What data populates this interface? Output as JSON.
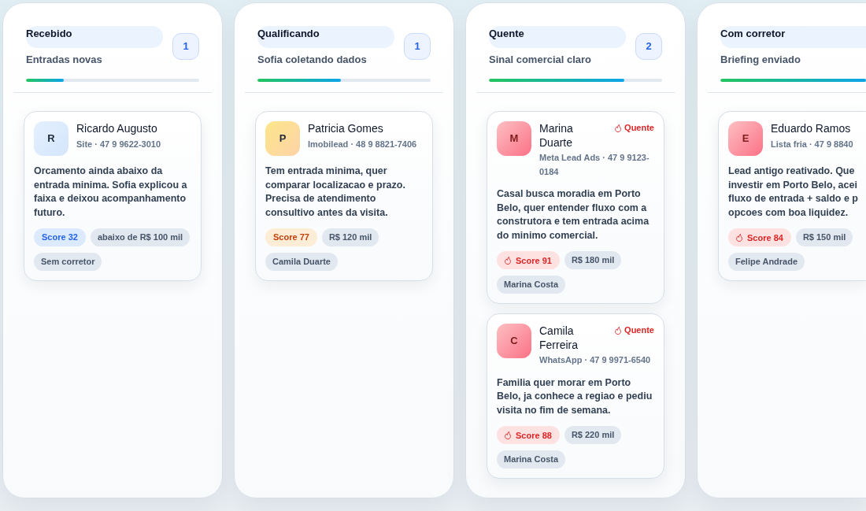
{
  "columns": [
    {
      "title": "Recebido",
      "subtitle": "Entradas novas",
      "count": "1",
      "level": 0.22,
      "cards": [
        {
          "initial": "R",
          "name": "Ricardo Augusto",
          "source": "Site · 47 9 9622-3010",
          "kind": "cold",
          "description": "Orcamento ainda abaixo da entrada minima. Sofia explicou a faixa e deixou acompanhamento futuro.",
          "score": "Score 32",
          "tags": [
            "abaixo de R$ 100 mil",
            "Sem corretor"
          ]
        }
      ]
    },
    {
      "title": "Qualificando",
      "subtitle": "Sofia coletando dados",
      "count": "1",
      "level": 0.48,
      "cards": [
        {
          "initial": "P",
          "name": "Patricia Gomes",
          "source": "Imobilead · 48 9 8821-7406",
          "kind": "warm",
          "description": "Tem entrada minima, quer comparar localizacao e prazo. Precisa de atendimento consultivo antes da visita.",
          "score": "Score 77",
          "tags": [
            "R$ 120 mil",
            "Camila Duarte"
          ]
        }
      ]
    },
    {
      "title": "Quente",
      "subtitle": "Sinal comercial claro",
      "count": "2",
      "level": 0.78,
      "cards": [
        {
          "initial": "M",
          "name": "Marina Duarte",
          "badge": "Quente",
          "source": "Meta Lead Ads · 47 9 9123-0184",
          "kind": "hot",
          "description": "Casal busca moradia em Porto Belo, quer entender fluxo com a construtora e tem entrada acima do minimo comercial.",
          "score": "Score 91",
          "tags": [
            "R$ 180 mil",
            "Marina Costa"
          ]
        },
        {
          "initial": "C",
          "name": "Camila Ferreira",
          "badge": "Quente",
          "source": "WhatsApp · 47 9 9971-6540",
          "kind": "hot",
          "description": "Familia quer morar em Porto Belo, ja conhece a regiao e pediu visita no fim de semana.",
          "score": "Score 88",
          "tags": [
            "R$ 220 mil",
            "Marina Costa"
          ]
        }
      ]
    },
    {
      "title": "Com corretor",
      "subtitle": "Briefing enviado",
      "level": 1,
      "cards": [
        {
          "initial": "E",
          "name": "Eduardo Ramos",
          "source": "Lista fria · 47 9 8840",
          "kind": "hot",
          "description": "Lead antigo reativado. Que\ninvestir em Porto Belo, acei\nfluxo de entrada + saldo e p\nopcoes com boa liquidez.",
          "score": "Score 84",
          "tags": [
            "R$ 150 mil",
            "Felipe Andrade"
          ]
        }
      ]
    }
  ]
}
